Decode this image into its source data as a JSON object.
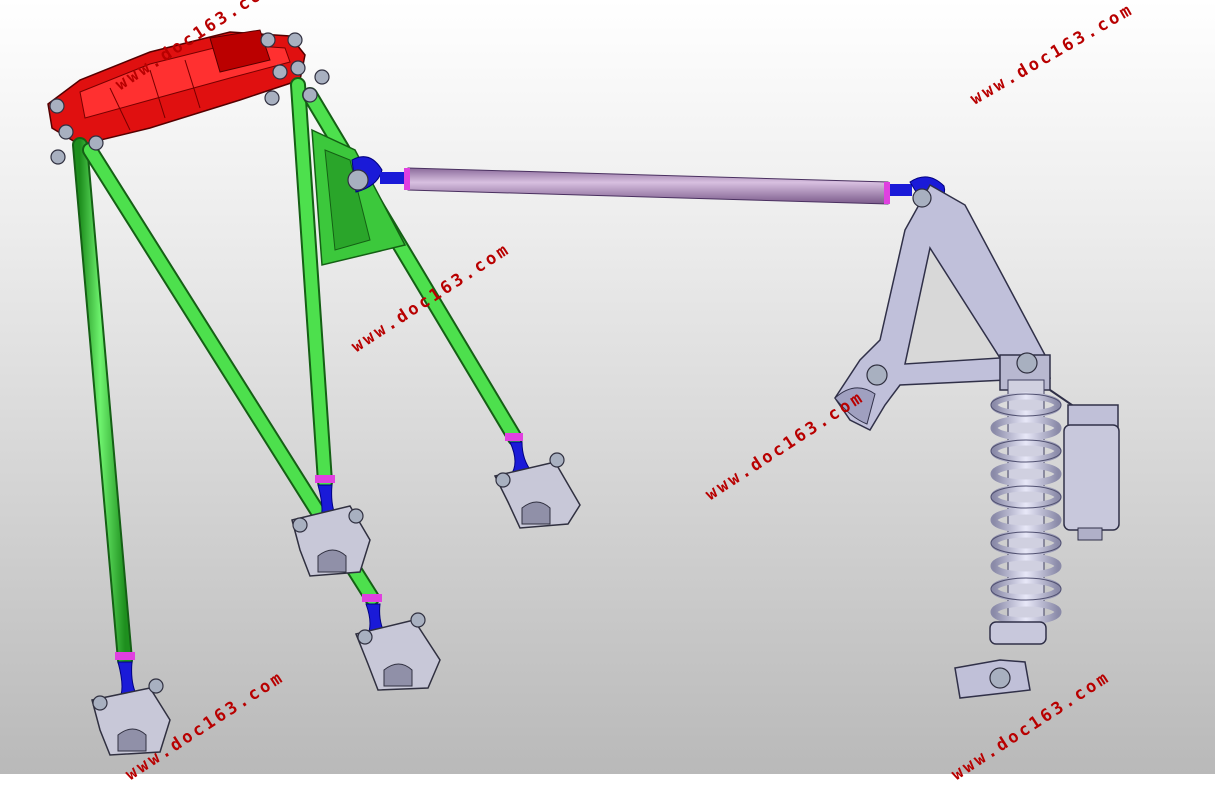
{
  "watermark": {
    "text": "www.doc163.com",
    "color": "#b80000"
  },
  "colors": {
    "background_top": "#ffffff",
    "background_bottom": "#b9b9b9",
    "subframe_bracket": "#e01010",
    "control_arms": "#33cc33",
    "rod_ends": "#1a1ad8",
    "mount_brackets": "#c8c8d8",
    "pushrod": "#b090c0",
    "rocker_and_damper": "#c0c0da",
    "bolts": "#a8b0c0"
  },
  "icons": [
    "subframe-bracket-part",
    "wishbone-part",
    "pushrod-part",
    "rocker-part",
    "coilover-damper-part",
    "mount-bracket-part"
  ]
}
